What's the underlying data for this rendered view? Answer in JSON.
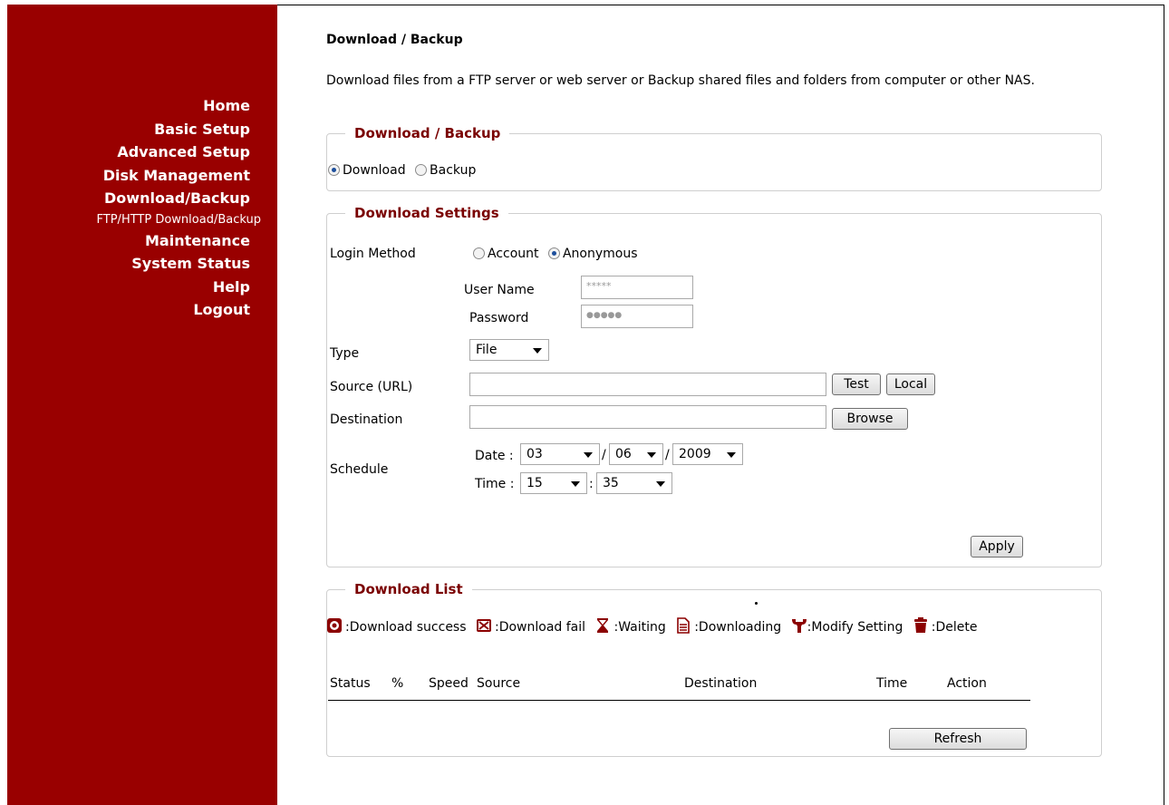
{
  "sidebar": {
    "items": [
      {
        "label": "Home"
      },
      {
        "label": "Basic Setup"
      },
      {
        "label": "Advanced Setup"
      },
      {
        "label": "Disk Management"
      },
      {
        "label": "Download/Backup"
      },
      {
        "label": "FTP/HTTP Download/Backup",
        "sub": true
      },
      {
        "label": "Maintenance"
      },
      {
        "label": "System Status"
      },
      {
        "label": "Help"
      },
      {
        "label": "Logout"
      }
    ]
  },
  "page": {
    "title": "Download / Backup",
    "description": "Download files from a FTP server or web server or Backup shared files and folders from computer or other NAS."
  },
  "mode_box": {
    "legend": "Download / Backup",
    "download_label": "Download",
    "backup_label": "Backup",
    "selected": "Download"
  },
  "settings": {
    "legend": "Download Settings",
    "login_method_label": "Login Method",
    "account_label": "Account",
    "anonymous_label": "Anonymous",
    "login_selected": "Anonymous",
    "username_label": "User Name",
    "username_value": "*****",
    "password_label": "Password",
    "password_value": "●●●●●",
    "type_label": "Type",
    "type_value": "File",
    "source_label": "Source (URL)",
    "source_value": "",
    "test_button": "Test",
    "local_button": "Local",
    "destination_label": "Destination",
    "destination_value": "",
    "browse_button": "Browse",
    "schedule_label": "Schedule",
    "date_label": "Date :",
    "date_day": "03",
    "date_month": "06",
    "date_year": "2009",
    "date_sep": "/",
    "time_label": "Time :",
    "time_hour": "15",
    "time_sep": ":",
    "time_minute": "35",
    "apply_button": "Apply"
  },
  "download_list": {
    "legend": "Download List",
    "icon_legend": [
      {
        "icon": "download-success-icon",
        "label": ":Download success"
      },
      {
        "icon": "download-fail-icon",
        "label": ":Download fail"
      },
      {
        "icon": "hourglass-icon",
        "label": ":Waiting"
      },
      {
        "icon": "document-icon",
        "label": ":Downloading"
      },
      {
        "icon": "wrench-icon",
        "label": ":Modify Setting"
      },
      {
        "icon": "trash-icon",
        "label": ":Delete"
      }
    ],
    "columns": [
      "Status",
      "%",
      "Speed",
      "Source",
      "Destination",
      "Time",
      "Action"
    ],
    "refresh_button": "Refresh"
  },
  "colors": {
    "sidebar_bg": "#990000",
    "legend_text": "#7a0000"
  }
}
